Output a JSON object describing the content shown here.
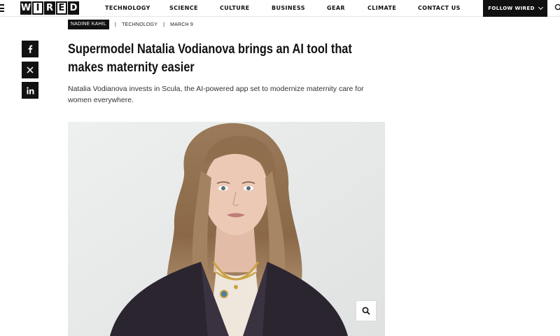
{
  "header": {
    "logo_letters": [
      "W",
      "I",
      "R",
      "E",
      "D"
    ],
    "nav": [
      {
        "label": "TECHNOLOGY"
      },
      {
        "label": "SCIENCE"
      },
      {
        "label": "CULTURE"
      },
      {
        "label": "BUSINESS"
      },
      {
        "label": "GEAR"
      },
      {
        "label": "CLIMATE"
      },
      {
        "label": "CONTACT US"
      }
    ],
    "follow_label": "FOLLOW WIRED"
  },
  "byline": {
    "author": "NADINE KAHIL",
    "separator": "|",
    "category": "TECHNOLOGY",
    "date": "MARCH 9"
  },
  "social": {
    "icons": [
      "facebook-icon",
      "x-icon",
      "linkedin-icon"
    ]
  },
  "article": {
    "headline": "Supermodel Natalia Vodianova brings an AI tool that makes maternity easier",
    "dek": "Natalia Vodianova invests in Scula, the AI-powered app set to modernize maternity care for women everywhere."
  },
  "hero": {
    "zoom_icon": "magnifier-icon"
  },
  "colors": {
    "ink": "#111111",
    "background": "#ffffff",
    "hero_backdrop": "#e9ebea",
    "hair": "#8a6a4b",
    "jacket": "#2b2530",
    "skin": "#e8c7b3"
  }
}
